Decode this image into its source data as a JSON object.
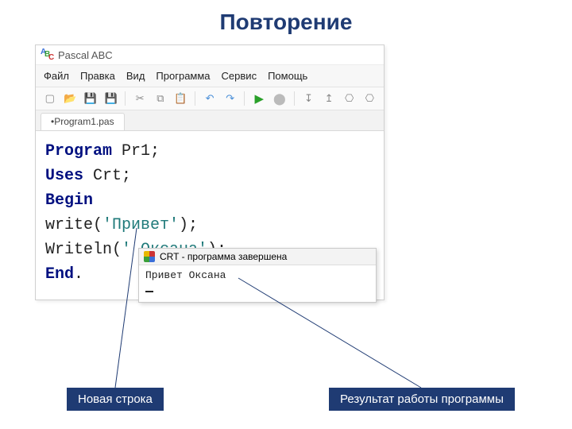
{
  "slide": {
    "title": "Повторение"
  },
  "ide": {
    "app_title": "Pascal ABC",
    "menu": [
      "Файл",
      "Правка",
      "Вид",
      "Программа",
      "Сервис",
      "Помощь"
    ],
    "tab": "•Program1.pas",
    "code": {
      "l1_kw": "Program",
      "l1_rest": " Pr1;",
      "l2_kw": "Uses",
      "l2_rest": " Crt;",
      "l3_kw": "Begin",
      "l4_pre": "write(",
      "l4_str": "'Привет'",
      "l4_post": ");",
      "l5_pre": "Writeln(",
      "l5_str": "' Оксана'",
      "l5_post": ");",
      "l6_kw": "End",
      "l6_post": "."
    }
  },
  "crt": {
    "title": "CRT - программа завершена",
    "output": "Привет Оксана"
  },
  "callouts": {
    "new_line": "Новая строка",
    "result": "Результат работы программы"
  },
  "icons": {
    "new": "▢",
    "open": "📂",
    "save": "💾",
    "saveall": "💾",
    "cut": "✂",
    "copy": "⧉",
    "paste": "📋",
    "undo": "↶",
    "redo": "↷",
    "run": "▶",
    "stop": "⬤",
    "stepin": "↧",
    "stepout": "↥",
    "break": "⎔",
    "break2": "⎔"
  }
}
